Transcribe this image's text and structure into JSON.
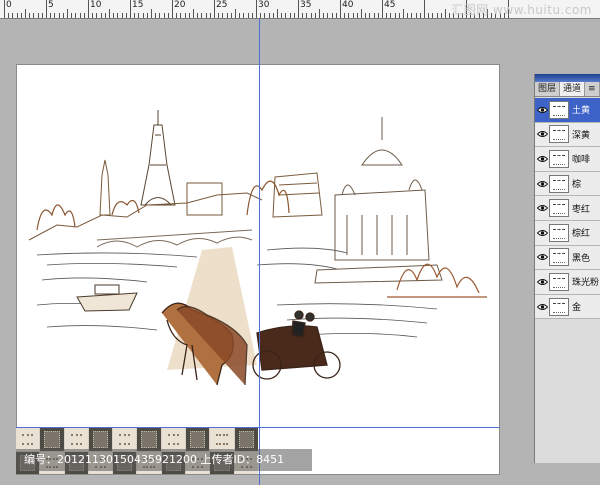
{
  "watermark_top": "汇图网 www.huitu.com",
  "ruler": {
    "labels": [
      "0",
      "5",
      "10",
      "15",
      "20",
      "25",
      "30",
      "35",
      "40",
      "45"
    ]
  },
  "canvas": {
    "background": "#ffffff",
    "guide_color": "#4f6ed6"
  },
  "footer": {
    "text": "编号：20121130150435921200 上传者ID：8451"
  },
  "panel": {
    "tabs": [
      "图层",
      "通道",
      "≡"
    ],
    "active_tab": 1,
    "channels": [
      {
        "name": "土黄",
        "selected": true
      },
      {
        "name": "深黄",
        "selected": false
      },
      {
        "name": "咖啡",
        "selected": false
      },
      {
        "name": "棕",
        "selected": false
      },
      {
        "name": "枣红",
        "selected": false
      },
      {
        "name": "棕红",
        "selected": false
      },
      {
        "name": "黑色",
        "selected": false
      },
      {
        "name": "珠光粉",
        "selected": false
      },
      {
        "name": "金",
        "selected": false
      }
    ]
  },
  "colors": {
    "workspace": "#b4b4b4",
    "selection": "#3d63c9",
    "sketch_brown": "#6b3a1f",
    "sketch_tan": "#c9a27a"
  }
}
